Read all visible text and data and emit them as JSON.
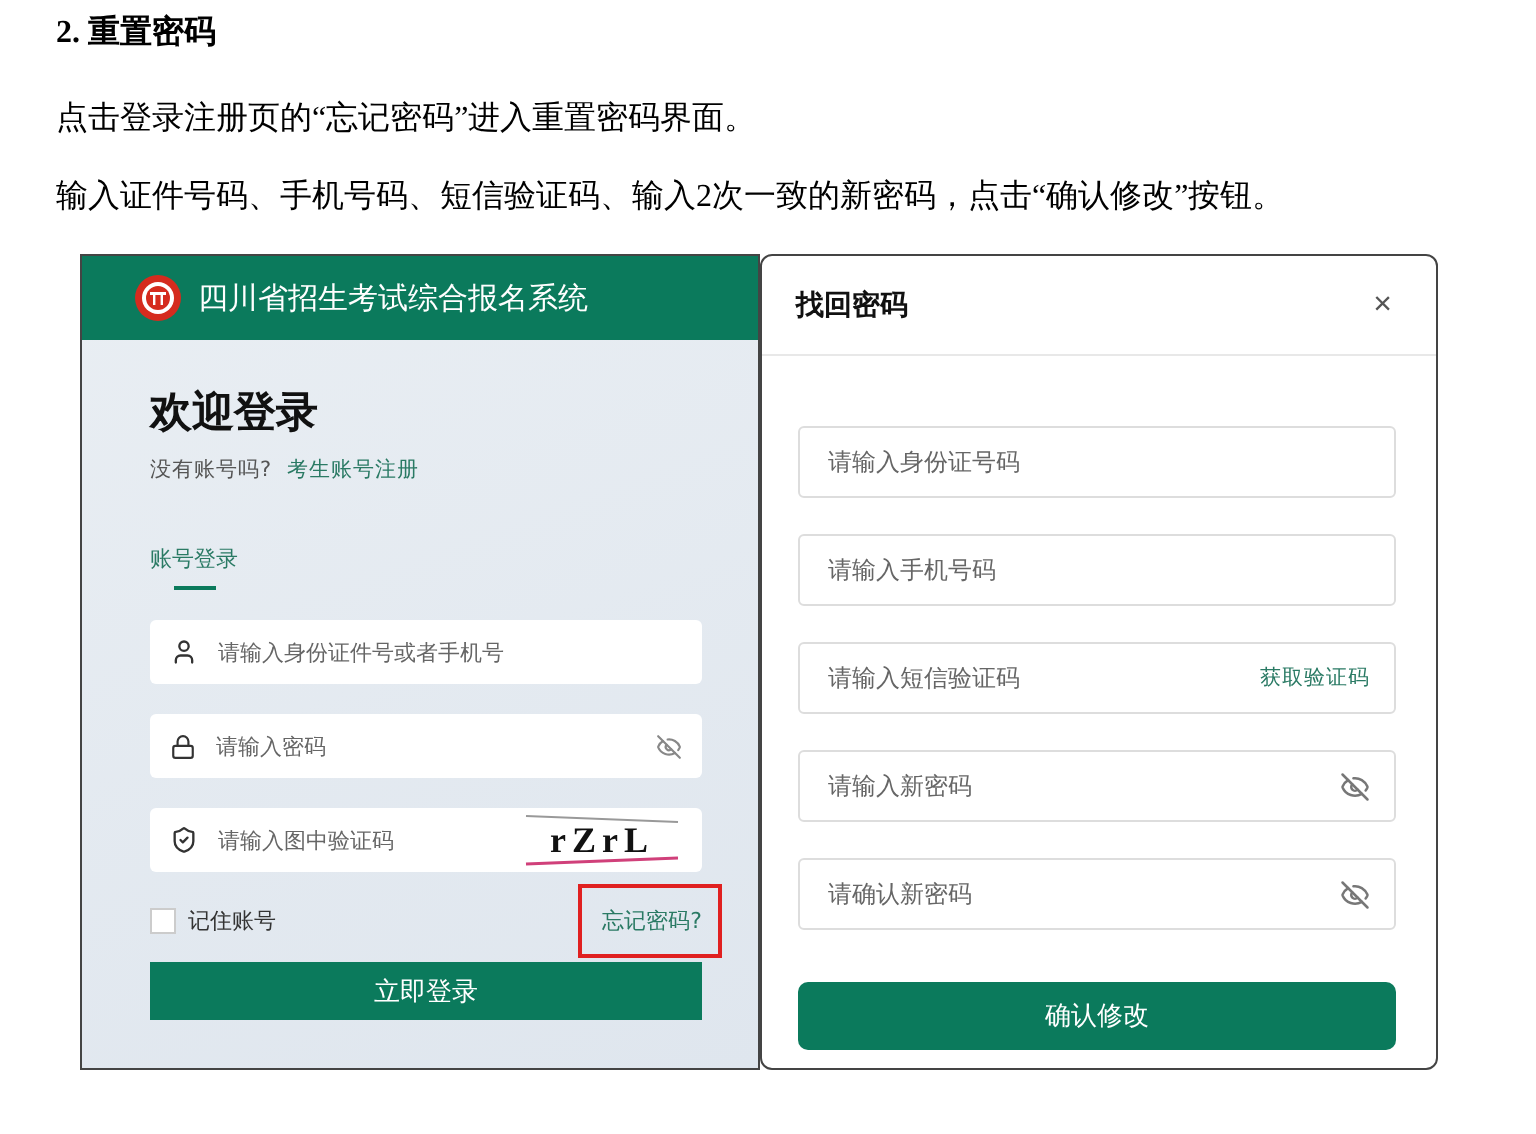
{
  "heading": "2. 重置密码",
  "paragraphs": [
    "点击登录注册页的“忘记密码”进入重置密码界面。",
    "输入证件号码、手机号码、短信验证码、输入2次一致的新密码，点击“确认修改”按钮。"
  ],
  "login": {
    "system_name": "四川省招生考试综合报名系统",
    "title": "欢迎登录",
    "register_prompt": "没有账号吗?",
    "register_link": "考生账号注册",
    "tabs": [
      {
        "label": "账号登录",
        "selected": true
      }
    ],
    "fields": [
      {
        "kind": "user",
        "placeholder": "请输入身份证件号或者手机号"
      },
      {
        "kind": "password",
        "placeholder": "请输入密码"
      },
      {
        "kind": "captcha",
        "placeholder": "请输入图中验证码",
        "captcha": "rZrL"
      }
    ],
    "remember": {
      "label": "记住账号",
      "checked": false
    },
    "forgot_link": "忘记密码?",
    "forgot_highlighted": true,
    "submit": "立即登录"
  },
  "reset_dialog": {
    "title": "找回密码",
    "close": "×",
    "fields": [
      {
        "kind": "text",
        "placeholder": "请输入身份证号码"
      },
      {
        "kind": "text",
        "placeholder": "请输入手机号码"
      },
      {
        "kind": "sms",
        "placeholder": "请输入短信验证码",
        "action": "获取验证码"
      },
      {
        "kind": "password",
        "placeholder": "请输入新密码"
      },
      {
        "kind": "password",
        "placeholder": "请确认新密码"
      }
    ],
    "submit": "确认修改"
  }
}
